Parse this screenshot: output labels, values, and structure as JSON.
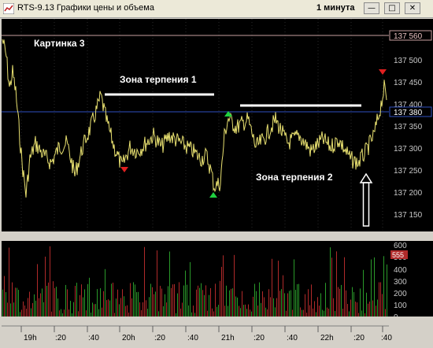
{
  "window": {
    "title": "RTS-9.13 Графики цены и объема",
    "interval": "1 минута",
    "minimize_symbol": "—",
    "restore_symbol": "□",
    "close_symbol": "✕"
  },
  "annotations": {
    "picture_label": "Картинка 3",
    "zone1_label": "Зона терпения 1",
    "zone2_label": "Зона терпения 2"
  },
  "price_axis": {
    "ticks": [
      "137 500",
      "137 450",
      "137 400",
      "137 350",
      "137 300",
      "137 250",
      "137 200",
      "137 150"
    ],
    "upper_level": "137 560",
    "current_level": "137 380"
  },
  "volume_axis": {
    "ticks": [
      "600",
      "500",
      "400",
      "300",
      "200",
      "100",
      "0"
    ],
    "current_volume": "555"
  },
  "time_axis": {
    "ticks": [
      "19h",
      ":20",
      ":40",
      "20h",
      ":20",
      ":40",
      "21h",
      ":20",
      ":40",
      "22h",
      ":20",
      ":40"
    ]
  },
  "colors": {
    "background": "#000000",
    "price_line": "#e8e070",
    "level_line_upper": "#c8a0a0",
    "level_line_current": "#3050c0",
    "zone_line": "#ffffff",
    "volume_up": "#2a9a2a",
    "volume_down": "#b02a2a",
    "marker_up": "#20d040",
    "marker_down": "#e02020"
  }
}
